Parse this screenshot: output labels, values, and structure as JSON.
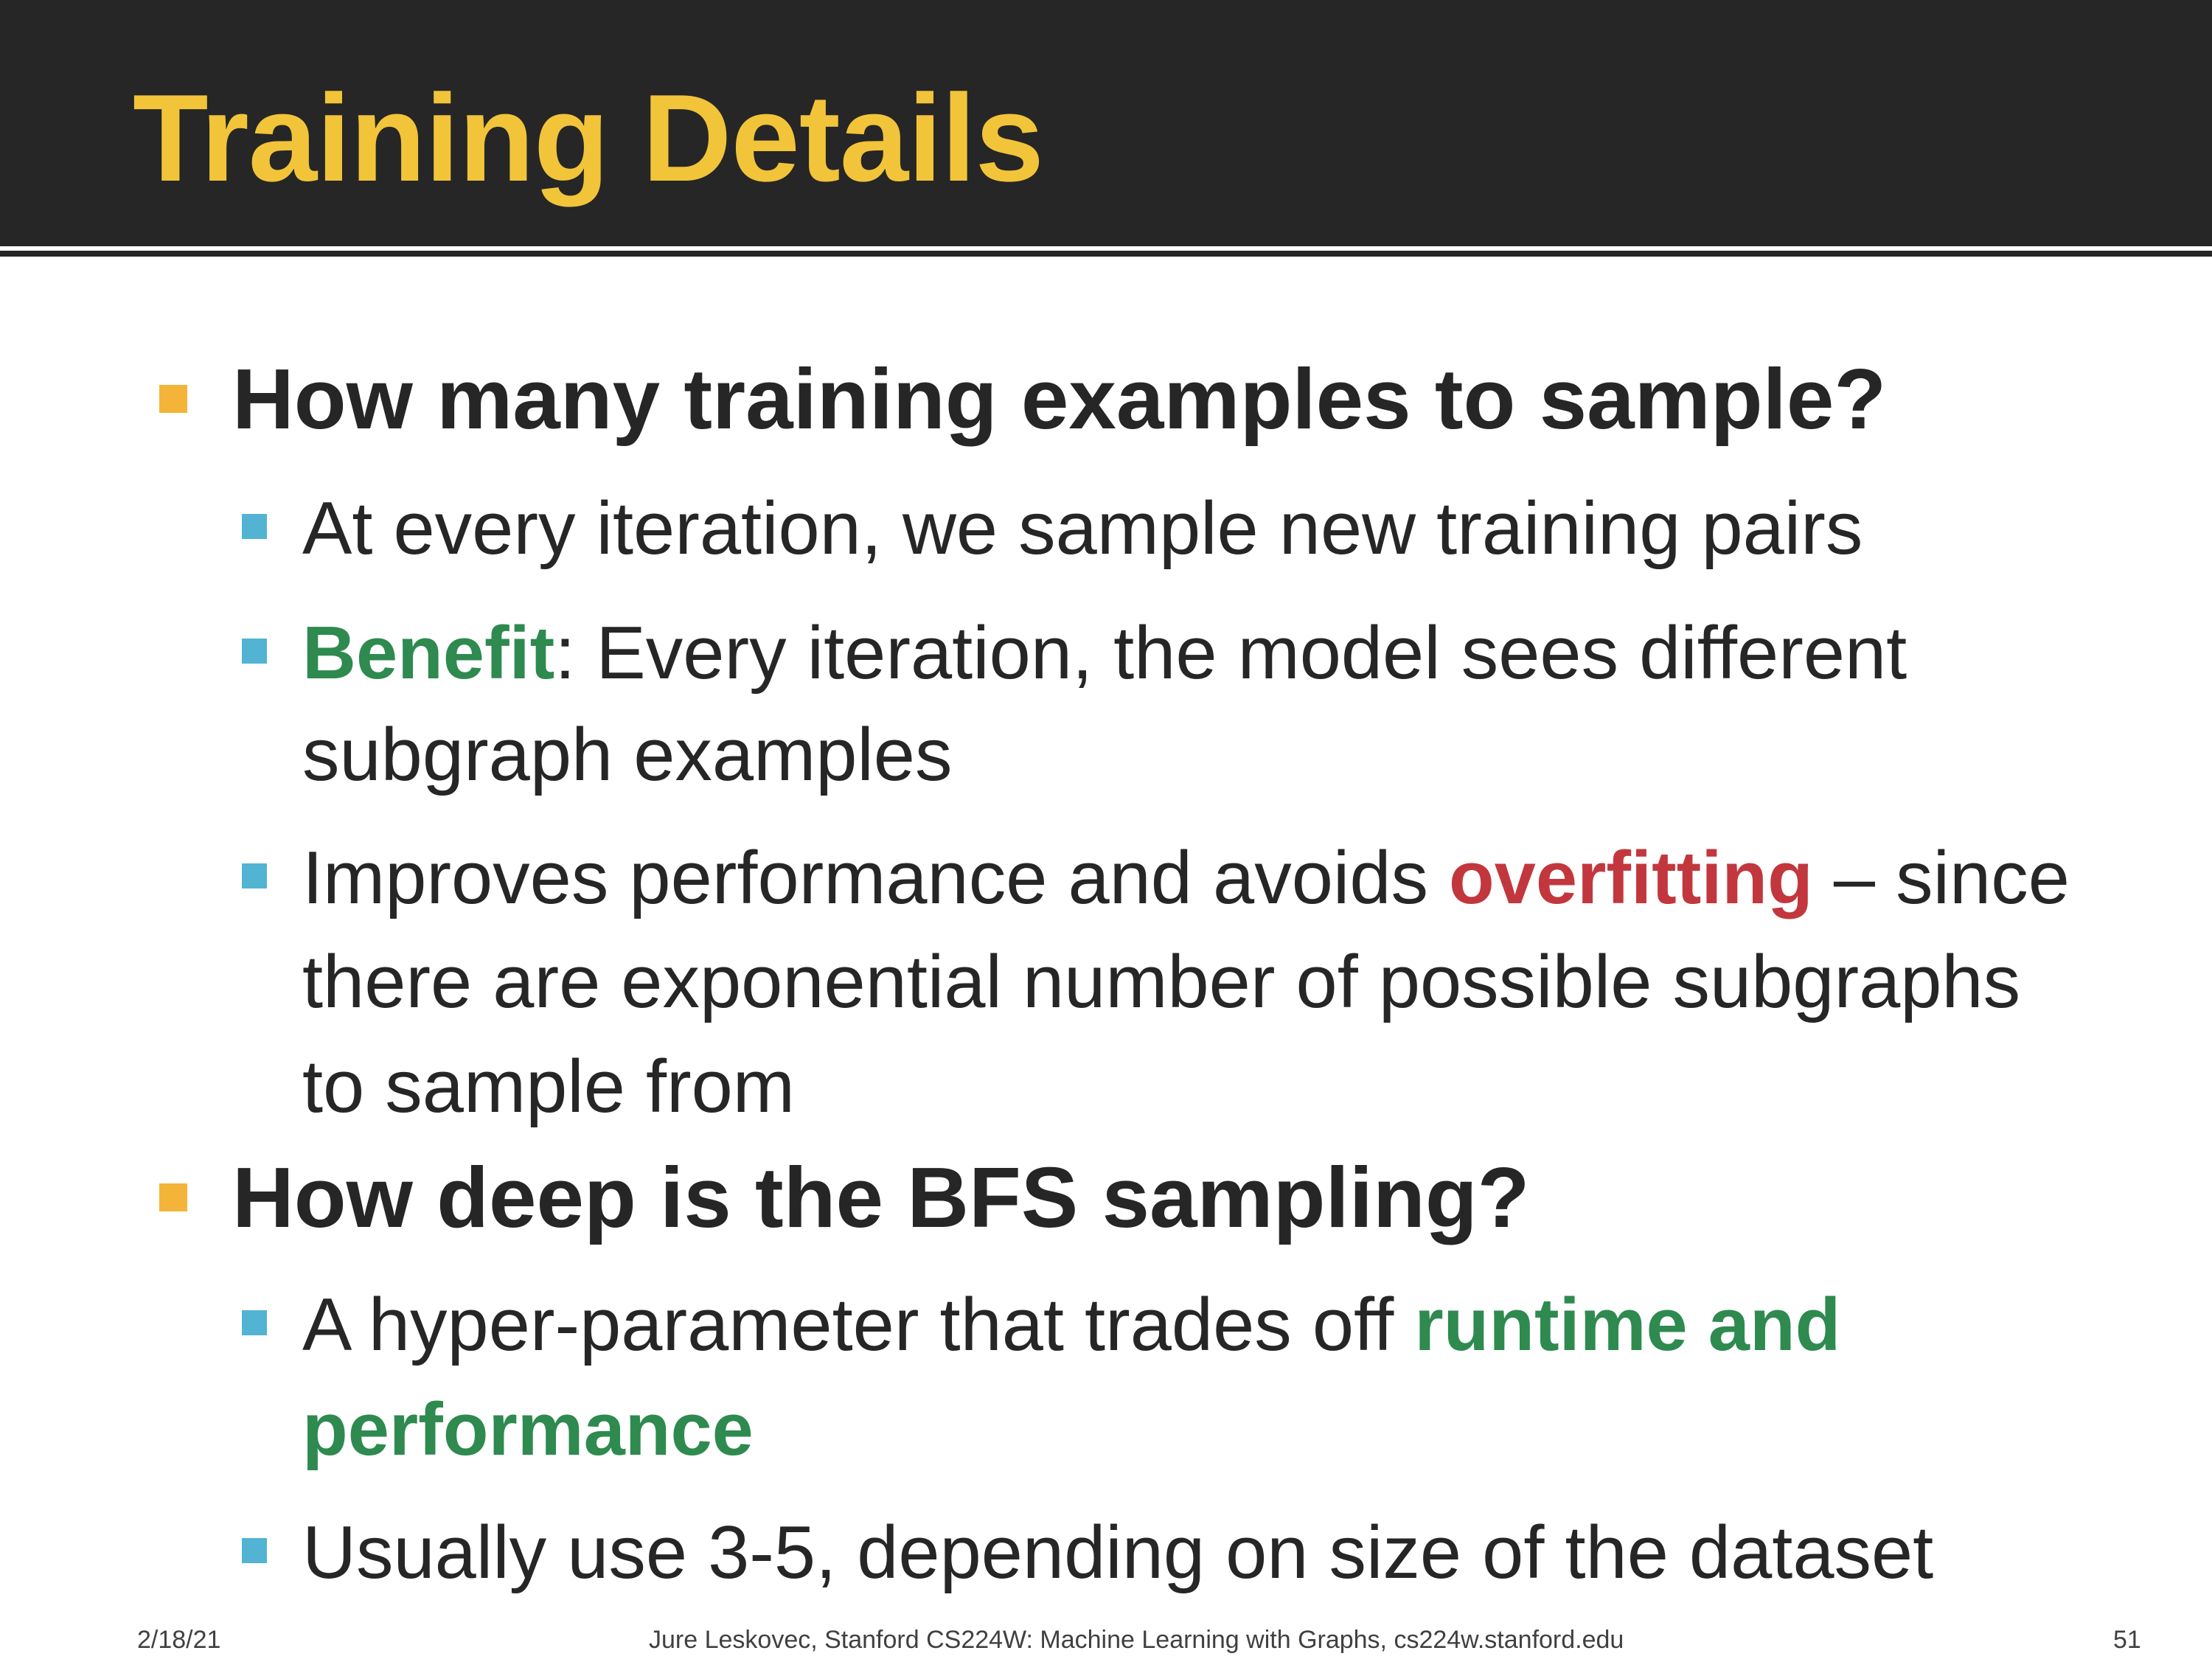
{
  "slide": {
    "title": "Training Details"
  },
  "bullets": {
    "b1": {
      "text": "How many training examples to sample?"
    },
    "b1_1": {
      "text": "At every iteration, we sample new training pairs"
    },
    "b1_2": {
      "emphasis": "Benefit",
      "line1_rest": ": Every iteration, the model sees different",
      "line2": "subgraph examples"
    },
    "b1_3": {
      "line1_pre": "Improves performance and avoids ",
      "emphasis": "overfitting",
      "line1_post": " – since",
      "line2": "there are exponential number of possible subgraphs",
      "line3": "to sample from"
    },
    "b2": {
      "text": "How deep is the BFS sampling?"
    },
    "b2_1": {
      "line1_pre": "A hyper-parameter that trades off ",
      "emphasis_line1": "runtime and",
      "emphasis_line2": "performance"
    },
    "b2_2": {
      "text": "Usually use 3-5, depending on size of the dataset"
    }
  },
  "footer": {
    "date": "2/18/21",
    "credit": "Jure Leskovec, Stanford CS224W: Machine Learning with Graphs, cs224w.stanford.edu",
    "page_number": "51"
  },
  "colors": {
    "title": "#f2c43a",
    "header_bg": "#262626",
    "level1_marker": "#f4b43a",
    "level2_marker": "#52b3d2",
    "emphasis_green": "#2e8a4f",
    "emphasis_red": "#c2373d",
    "body_text": "#262626"
  }
}
